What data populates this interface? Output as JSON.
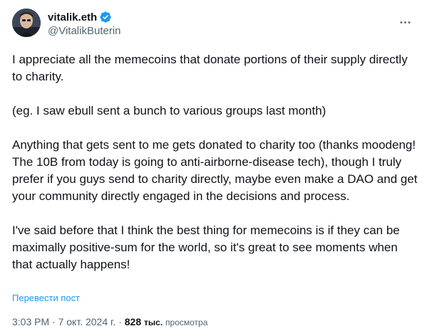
{
  "author": {
    "display_name": "vitalik.eth",
    "handle": "@VitalikButerin",
    "verified": true,
    "avatar_icon": "person-avatar-icon"
  },
  "colors": {
    "text": "#0f1419",
    "muted": "#536471",
    "link": "#1d9bf0",
    "verified_badge": "#1d9bf0"
  },
  "tweet": {
    "paragraphs": [
      "I appreciate all the memecoins that donate portions of their supply directly to charity.",
      "(eg. I saw ebull sent a bunch to various groups last month)",
      "Anything that gets sent to me gets donated to charity too (thanks moodeng! The 10B from today is going to anti-airborne-disease tech), though I truly prefer if you guys send to charity directly, maybe even make a DAO and get your community directly engaged in the decisions and process.",
      "I've said before that I think the best thing for memecoins is if they can be maximally positive-sum for the world, so it's great to see moments when that actually happens!"
    ],
    "translate_label": "Перевести пост"
  },
  "meta": {
    "time": "3:03 PM",
    "separator": "·",
    "date": "7 окт. 2024 г.",
    "views_count": "828",
    "views_unit": "тыс.",
    "views_label": "просмотра"
  },
  "more_icon": "more-horizontal-icon"
}
